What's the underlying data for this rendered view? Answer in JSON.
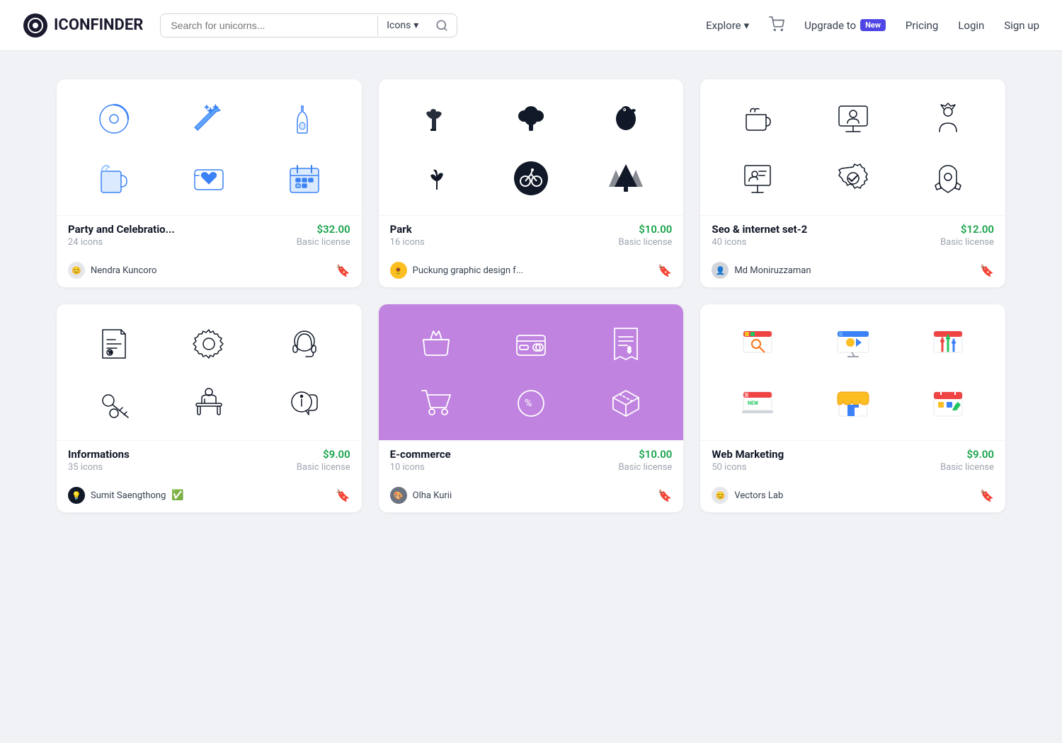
{
  "header": {
    "logo_text": "ICONFINDER",
    "search_placeholder": "Search for unicorns...",
    "search_type_label": "Icons",
    "explore_label": "Explore",
    "upgrade_label": "Upgrade to",
    "new_badge": "New",
    "pricing_label": "Pricing",
    "login_label": "Login",
    "signup_label": "Sign up"
  },
  "cards": [
    {
      "id": "party",
      "title": "Party and Celebratio...",
      "count": "24 icons",
      "price": "$32.00",
      "license": "Basic license",
      "author": "Nendra Kuncoro",
      "verified": false,
      "style": "blue-outline",
      "bg": "white"
    },
    {
      "id": "park",
      "title": "Park",
      "count": "16 icons",
      "price": "$10.00",
      "license": "Basic license",
      "author": "Puckung graphic design f...",
      "verified": false,
      "style": "solid-black",
      "bg": "white"
    },
    {
      "id": "seo",
      "title": "Seo & internet set-2",
      "count": "40 icons",
      "price": "$12.00",
      "license": "Basic license",
      "author": "Md Moniruzzaman",
      "verified": false,
      "style": "outline-black",
      "bg": "white"
    },
    {
      "id": "informations",
      "title": "Informations",
      "count": "35 icons",
      "price": "$9.00",
      "license": "Basic license",
      "author": "Sumit Saengthong",
      "verified": true,
      "style": "outline-black",
      "bg": "white"
    },
    {
      "id": "ecommerce",
      "title": "E-commerce",
      "count": "10 icons",
      "price": "$10.00",
      "license": "Basic license",
      "author": "Olha Kurii",
      "verified": false,
      "style": "outline-white",
      "bg": "purple"
    },
    {
      "id": "webmarketing",
      "title": "Web Marketing",
      "count": "50 icons",
      "price": "$9.00",
      "license": "Basic license",
      "author": "Vectors Lab",
      "verified": false,
      "style": "colored",
      "bg": "white"
    }
  ]
}
